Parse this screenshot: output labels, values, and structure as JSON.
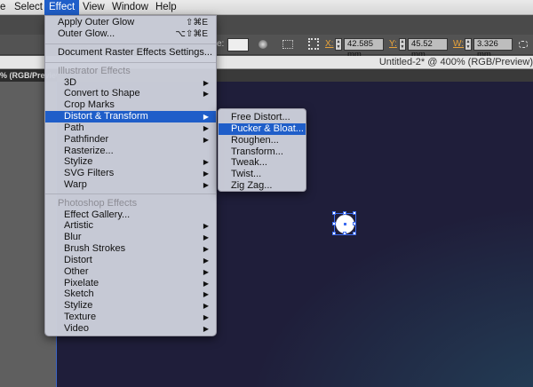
{
  "menubar": {
    "items": [
      "e",
      "Select",
      "Effect",
      "View",
      "Window",
      "Help"
    ],
    "active": "Effect"
  },
  "control_bar": {
    "x_label": "X:",
    "x_value": "42.585 mm",
    "y_label": "Y:",
    "y_value": "45.52 mm",
    "w_label": "W:",
    "w_value": "3.326 mm",
    "style_label": "e:"
  },
  "document": {
    "title": "Untitled-2* @ 400% (RGB/Preview)",
    "left_tab": "% (RGB/Preview)"
  },
  "effect_menu": {
    "apply_outer_glow": {
      "label": "Apply Outer Glow",
      "shortcut": "⇧⌘E"
    },
    "outer_glow": {
      "label": "Outer Glow...",
      "shortcut": "⌥⇧⌘E"
    },
    "doc_raster": "Document Raster Effects Settings...",
    "illustrator_heading": "Illustrator Effects",
    "illustrator_items": [
      {
        "label": "3D",
        "submenu": true
      },
      {
        "label": "Convert to Shape",
        "submenu": true
      },
      {
        "label": "Crop Marks",
        "submenu": false
      },
      {
        "label": "Distort & Transform",
        "submenu": true,
        "highlighted": true
      },
      {
        "label": "Path",
        "submenu": true
      },
      {
        "label": "Pathfinder",
        "submenu": true
      },
      {
        "label": "Rasterize...",
        "submenu": false
      },
      {
        "label": "Stylize",
        "submenu": true
      },
      {
        "label": "SVG Filters",
        "submenu": true
      },
      {
        "label": "Warp",
        "submenu": true
      }
    ],
    "photoshop_heading": "Photoshop Effects",
    "photoshop_items": [
      {
        "label": "Effect Gallery...",
        "submenu": false
      },
      {
        "label": "Artistic",
        "submenu": true
      },
      {
        "label": "Blur",
        "submenu": true
      },
      {
        "label": "Brush Strokes",
        "submenu": true
      },
      {
        "label": "Distort",
        "submenu": true
      },
      {
        "label": "Other",
        "submenu": true
      },
      {
        "label": "Pixelate",
        "submenu": true
      },
      {
        "label": "Sketch",
        "submenu": true
      },
      {
        "label": "Stylize",
        "submenu": true
      },
      {
        "label": "Texture",
        "submenu": true
      },
      {
        "label": "Video",
        "submenu": true
      }
    ]
  },
  "distort_submenu": {
    "items": [
      "Free Distort...",
      "Pucker & Bloat...",
      "Roughen...",
      "Transform...",
      "Tweak...",
      "Twist...",
      "Zig Zag..."
    ],
    "highlighted": "Pucker & Bloat..."
  },
  "submenu_arrow": "▶"
}
